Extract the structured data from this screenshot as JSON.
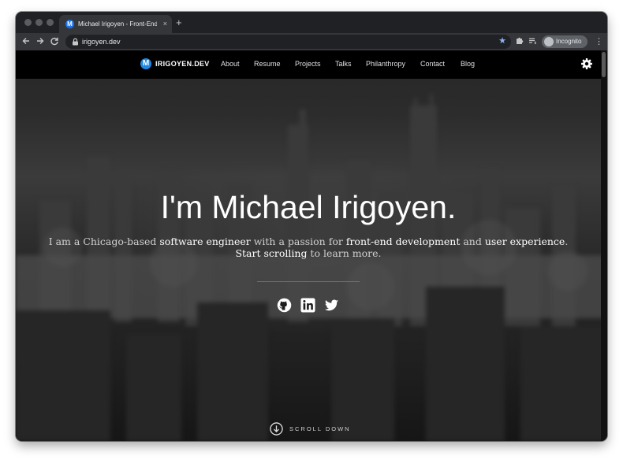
{
  "browser": {
    "tab_title": "Michael Irigoyen - Front-End S",
    "tab_favicon_letter": "M",
    "tab_close": "×",
    "new_tab": "+",
    "url": "irigoyen.dev",
    "profile_label": "Incognito"
  },
  "site": {
    "brand_letter": "M",
    "brand_name": "IRIGOYEN.DEV",
    "nav": [
      "About",
      "Resume",
      "Projects",
      "Talks",
      "Philanthropy",
      "Contact",
      "Blog"
    ]
  },
  "hero": {
    "headline": "I'm Michael Irigoyen.",
    "intro": {
      "p1": "I am a Chicago-based ",
      "e1": "software engineer",
      "p2": " with a passion for ",
      "e2": "front-end development",
      "p3": " and ",
      "e3": "user experience",
      "p4": ".",
      "e4": "Start scrolling",
      "p5": " to learn more."
    },
    "social_icons": [
      "github-icon",
      "linkedin-icon",
      "twitter-icon"
    ],
    "scroll_label": "SCROLL DOWN"
  },
  "colors": {
    "nav_bg": "#000000",
    "brand_accent": "#1e88e5",
    "browser_chrome": "#202124",
    "star": "#8ab4f8"
  }
}
